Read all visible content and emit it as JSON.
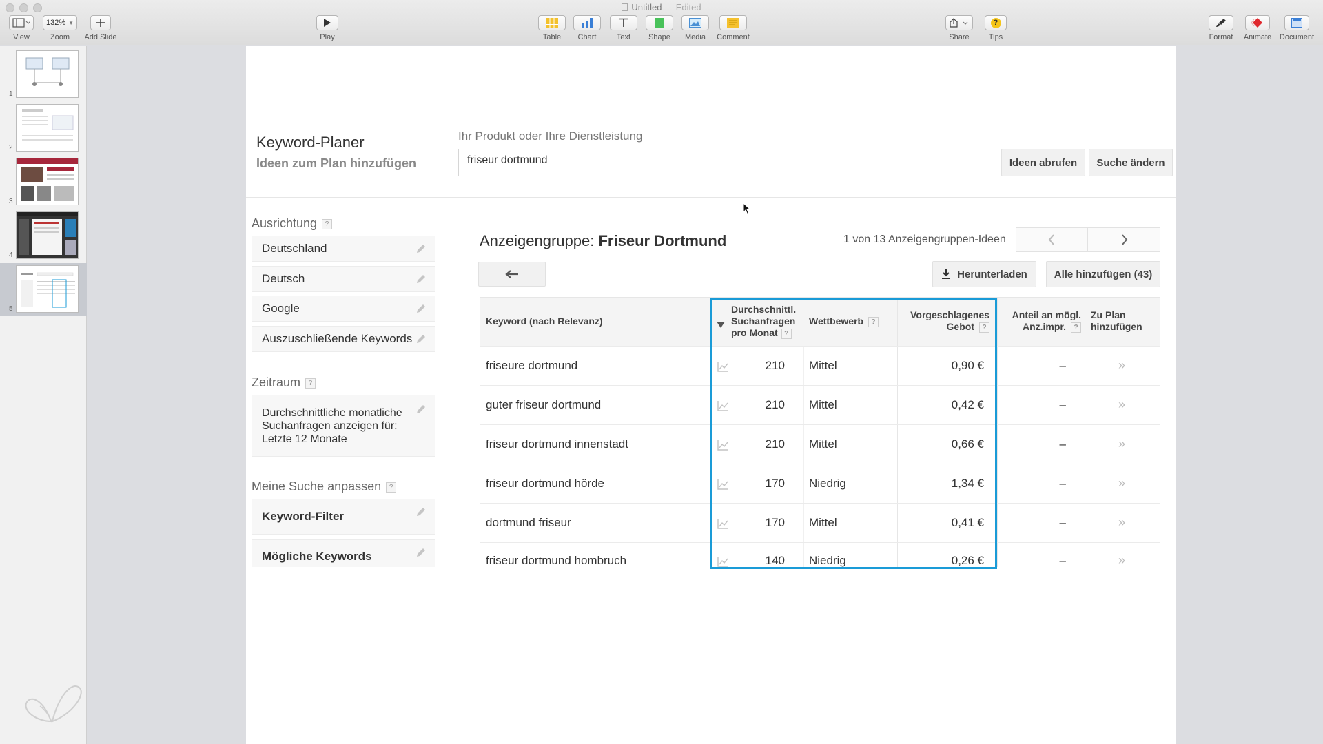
{
  "app": {
    "doc_title": "Untitled",
    "doc_status": "Edited"
  },
  "toolbar": {
    "view": "View",
    "zoom_value": "132%",
    "zoom": "Zoom",
    "add_slide": "Add Slide",
    "play": "Play",
    "table": "Table",
    "chart": "Chart",
    "text": "Text",
    "shape": "Shape",
    "media": "Media",
    "comment": "Comment",
    "share": "Share",
    "tips": "Tips",
    "format": "Format",
    "animate": "Animate",
    "document": "Document"
  },
  "slides": [
    "1",
    "2",
    "3",
    "4",
    "5"
  ],
  "page": {
    "title": "Keyword-Planer",
    "subtitle": "Ideen zum Plan hinzufügen",
    "product_label": "Ihr Produkt oder Ihre Dienstleistung",
    "search_value": "friseur dortmund",
    "get_ideas": "Ideen abrufen",
    "change_search": "Suche ändern"
  },
  "sidebar": {
    "targeting_label": "Ausrichtung",
    "help": "?",
    "targeting": [
      "Deutschland",
      "Deutsch",
      "Google",
      "Auszuschließende Keywords"
    ],
    "period_label": "Zeitraum",
    "period_text": [
      "Durchschnittliche monatliche",
      "Suchanfragen anzeigen für:",
      "Letzte 12 Monate"
    ],
    "customize_label": "Meine Suche anpassen",
    "filters": [
      "Keyword-Filter",
      "Mögliche Keywords"
    ]
  },
  "main": {
    "adgroup_prefix": "Anzeigengruppe:",
    "adgroup_name": "Friseur Dortmund",
    "pager": "1 von 13 Anzeigengruppen-Ideen",
    "download": "Herunterladen",
    "add_all": "Alle hinzufügen (43)",
    "columns": {
      "keyword": "Keyword (nach Relevanz)",
      "searches": [
        "Durchschnittl.",
        "Suchanfragen",
        "pro Monat"
      ],
      "competition": "Wettbewerb",
      "bid": [
        "Vorgeschlagenes",
        "Gebot"
      ],
      "share": [
        "Anteil an mögl.",
        "Anz.impr."
      ],
      "add": [
        "Zu Plan",
        "hinzufügen"
      ]
    },
    "rows": [
      {
        "keyword": "friseure dortmund",
        "searches": "210",
        "competition": "Mittel",
        "bid": "0,90 €",
        "share": "–"
      },
      {
        "keyword": "guter friseur dortmund",
        "searches": "210",
        "competition": "Mittel",
        "bid": "0,42 €",
        "share": "–"
      },
      {
        "keyword": "friseur dortmund innenstadt",
        "searches": "210",
        "competition": "Mittel",
        "bid": "0,66 €",
        "share": "–"
      },
      {
        "keyword": "friseur dortmund hörde",
        "searches": "170",
        "competition": "Niedrig",
        "bid": "1,34 €",
        "share": "–"
      },
      {
        "keyword": "dortmund friseur",
        "searches": "170",
        "competition": "Mittel",
        "bid": "0,41 €",
        "share": "–"
      },
      {
        "keyword": "friseur dortmund hombruch",
        "searches": "140",
        "competition": "Niedrig",
        "bid": "0,26 €",
        "share": "–"
      }
    ]
  },
  "colors": {
    "highlight": "#1a9bd7",
    "keynote_red": "#e0282e"
  }
}
